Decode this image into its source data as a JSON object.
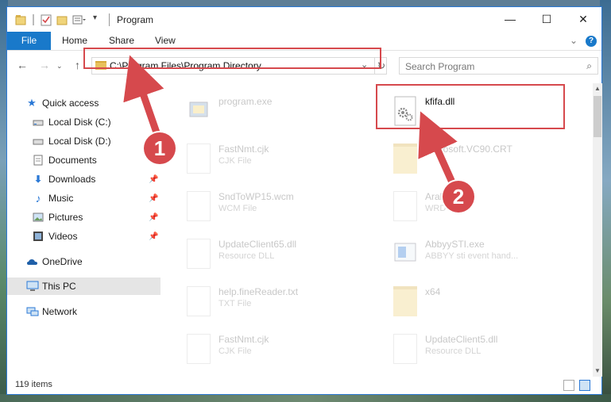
{
  "window": {
    "title": "Program",
    "controls": {
      "minimize": "—",
      "maximize": "☐",
      "close": "✕"
    }
  },
  "ribbon": {
    "tabs": [
      "File",
      "Home",
      "Share",
      "View"
    ],
    "help": "?"
  },
  "address": {
    "path": "C:\\Program Files\\Program Directory"
  },
  "search": {
    "placeholder": "Search Program"
  },
  "nav": {
    "items": [
      {
        "label": "Quick access",
        "icon": "star-icon",
        "pinned": false
      },
      {
        "label": "Local Disk (C:)",
        "icon": "drive-icon",
        "pinned": false
      },
      {
        "label": "Local Disk (D:)",
        "icon": "drive-icon",
        "pinned": false
      },
      {
        "label": "Documents",
        "icon": "documents-icon",
        "pinned": false
      },
      {
        "label": "Downloads",
        "icon": "download-icon",
        "pinned": true
      },
      {
        "label": "Music",
        "icon": "music-icon",
        "pinned": true
      },
      {
        "label": "Pictures",
        "icon": "pictures-icon",
        "pinned": true
      },
      {
        "label": "Videos",
        "icon": "videos-icon",
        "pinned": true
      },
      {
        "label": "OneDrive",
        "icon": "cloud-icon",
        "pinned": false
      },
      {
        "label": "This PC",
        "icon": "computer-icon",
        "pinned": false,
        "selected": true
      },
      {
        "label": "Network",
        "icon": "network-icon",
        "pinned": false
      }
    ]
  },
  "files": [
    {
      "name": "program.exe",
      "type": ""
    },
    {
      "name": "kfifa.dll",
      "type": ""
    },
    {
      "name": "FastNmt.cjk",
      "type": "CJK File"
    },
    {
      "name": "Microsoft.VC90.CRT",
      "type": ""
    },
    {
      "name": "SndToWP15.wcm",
      "type": "WCM File"
    },
    {
      "name": "Arabic",
      "type": "WRD File"
    },
    {
      "name": "UpdateClient65.dll",
      "type": "Resource DLL"
    },
    {
      "name": "AbbyySTI.exe",
      "type": "ABBYY sti event hand..."
    },
    {
      "name": "help.fineReader.txt",
      "type": "TXT File"
    },
    {
      "name": "x64",
      "type": ""
    },
    {
      "name": "FastNmt.cjk",
      "type": "CJK File"
    },
    {
      "name": "UpdateClient5.dll",
      "type": "Resource DLL"
    }
  ],
  "status": {
    "count": "119 items"
  },
  "annotations": {
    "step1": "1",
    "step2": "2",
    "color": "#d6494d"
  }
}
